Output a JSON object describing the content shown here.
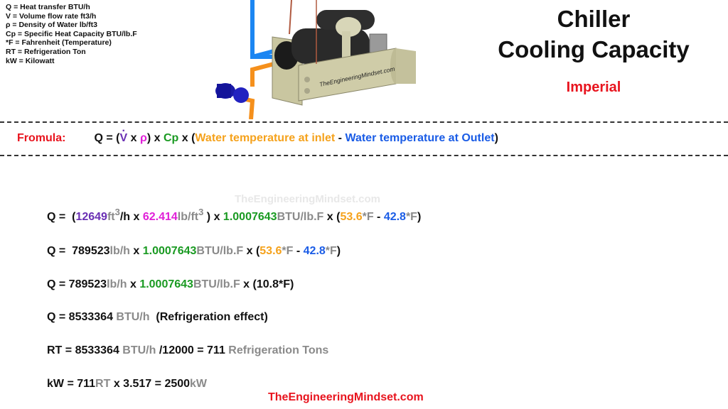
{
  "legend": [
    "Q = Heat transfer BTU/h",
    "V = Volume flow rate ft3/h",
    "ρ = Density of Water lb/ft3",
    "Cp = Specific Heat Capacity BTU/lb.F",
    "*F = Fahrenheit (Temperature)",
    "RT = Refrigeration Ton",
    "kW = Kilowatt"
  ],
  "title": {
    "line1": "Chiller",
    "line2": "Cooling Capacity",
    "subtitle": "Imperial"
  },
  "illustration": {
    "label": "TheEngineeringMindset.com",
    "icon": "chiller-illustration"
  },
  "formula": {
    "label": "Fromula:",
    "q": "Q = (",
    "v": "V",
    "x1": " x ",
    "rho": "ρ",
    "close1": ") x ",
    "cp": "Cp",
    "x2": " x (",
    "inlet": "Water temperature at inlet",
    "minus": " - ",
    "outlet": "Water temperature at Outlet",
    "close2": ")"
  },
  "watermark": "TheEngineeringMindset.com",
  "steps": {
    "s1": {
      "prefix": "Q =  (",
      "flow": "12649",
      "flow_unit": "ft",
      "cube": "3",
      "per_h": "/h x ",
      "density": "62.414",
      "density_unit": "lb/ft",
      "cube2": "3",
      "mid": " ) x ",
      "cp": "1.0007643",
      "cp_unit": "BTU/lb.F",
      "x": " x (",
      "t_in": "53.6",
      "f1": "*F",
      "minus": " - ",
      "t_out": "42.8",
      "f2": "*F",
      "end": ")"
    },
    "s2": {
      "prefix": "Q =  789523",
      "mass_unit": "lb/h",
      "x": " x ",
      "cp": "1.0007643",
      "cp_unit": "BTU/lb.F",
      "x2": " x (",
      "t_in": "53.6",
      "f1": "*F",
      "minus": " - ",
      "t_out": "42.8",
      "f2": "*F",
      "end": ")"
    },
    "s3": {
      "prefix": "Q = 789523",
      "mass_unit": "lb/h",
      "x": " x ",
      "cp": "1.0007643",
      "cp_unit": "BTU/lb.F",
      "tail": " x (10.8*F)"
    },
    "s4": {
      "prefix": "Q = 8533364 ",
      "unit": "BTU/h",
      "tail": "  (Refrigeration effect)"
    },
    "s5": {
      "prefix": "RT = 8533364 ",
      "unit": "BTU/h",
      "mid": " /12000 = 711 ",
      "tail": "Refrigeration Tons"
    },
    "s6": {
      "prefix": "kW = 711",
      "rt": "RT",
      "mid": " x 3.517 = 2500",
      "kw": "kW"
    }
  },
  "footer": "TheEngineeringMindset.com",
  "colors": {
    "red": "#e8141e",
    "purple": "#6a2fb4",
    "magenta": "#e020d8",
    "green": "#1a9a22",
    "orange": "#f5a21c",
    "blue": "#1a5ce6",
    "grey": "#8a8a8a"
  }
}
